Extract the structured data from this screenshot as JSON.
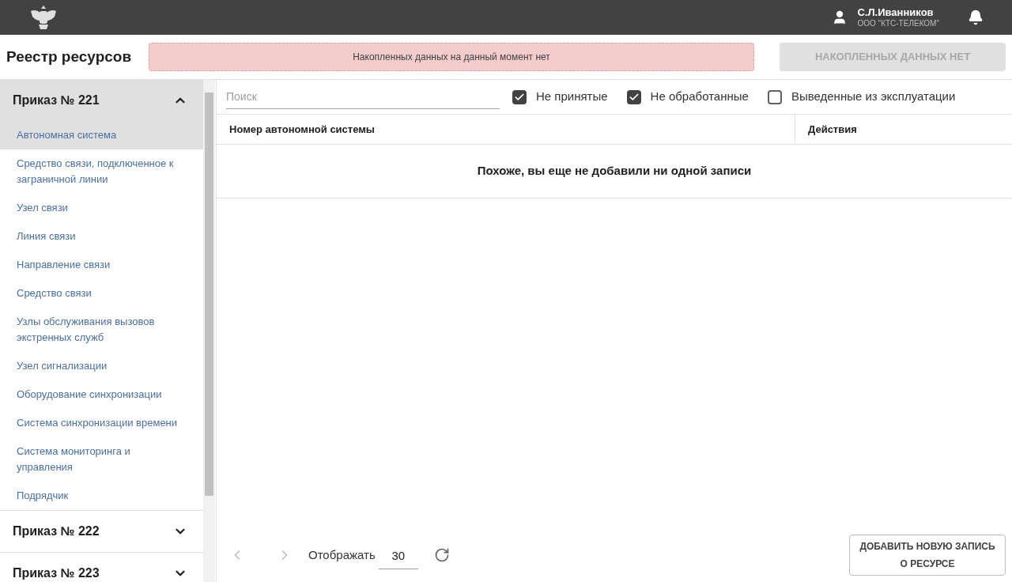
{
  "header": {
    "user_name": "С.Л.Иванников",
    "user_org": "ООО \"КТС-ТЕЛЕКОМ\""
  },
  "title": "Реестр ресурсов",
  "notice": "Накопленных данных на данный момент нет",
  "accumulated_button": {
    "label": "НАКОПЛЕННЫХ ДАННЫХ НЕТ",
    "disabled": true
  },
  "sidebar": {
    "groups": [
      {
        "title": "Приказ № 221",
        "expanded": true,
        "children": [
          {
            "label": "Автономная система",
            "selected": true
          },
          {
            "label": "Средство связи, подключенное к заграничной линии",
            "selected": false
          },
          {
            "label": "Узел связи",
            "selected": false
          },
          {
            "label": "Линия связи",
            "selected": false
          },
          {
            "label": "Направление связи",
            "selected": false
          },
          {
            "label": "Средство связи",
            "selected": false
          },
          {
            "label": "Узлы обслуживания вызовов экстренных служб",
            "selected": false
          },
          {
            "label": "Узел сигнализации",
            "selected": false
          },
          {
            "label": "Оборудование синхронизации",
            "selected": false
          },
          {
            "label": "Система синхронизации времени",
            "selected": false
          },
          {
            "label": "Система мониторинга и управления",
            "selected": false
          },
          {
            "label": "Подрядчик",
            "selected": false
          }
        ]
      },
      {
        "title": "Приказ № 222",
        "expanded": false
      },
      {
        "title": "Приказ № 223",
        "expanded": false
      }
    ]
  },
  "search": {
    "placeholder": "Поиск"
  },
  "filters": [
    {
      "label": "Не принятые",
      "checked": true
    },
    {
      "label": "Не обработанные",
      "checked": true
    },
    {
      "label": "Выведенные из эксплуатации",
      "checked": false
    }
  ],
  "table": {
    "columns": [
      "Номер автономной системы",
      "Действия"
    ],
    "empty_message": "Похоже, вы еще не добавили ни одной записи"
  },
  "pagination": {
    "prev_disabled": true,
    "next_disabled": true,
    "page_size_label": "Отображать",
    "page_size": "30"
  },
  "add_button": {
    "label": "ДОБАВИТЬ НОВУЮ ЗАПИСЬ О РЕСУРСЕ"
  }
}
